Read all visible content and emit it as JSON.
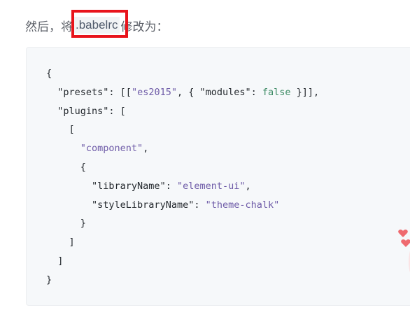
{
  "intro": {
    "prefix": "然后，将",
    "filename": ".babelrc",
    "suffix": "修改为："
  },
  "code": {
    "l1_open": "{",
    "l2_key": "\"presets\"",
    "l2_mid1": ": [[",
    "l2_es": "\"es2015\"",
    "l2_mid2": ", { ",
    "l2_modules": "\"modules\"",
    "l2_colon": ": ",
    "l2_false": "false",
    "l2_end": " }]],",
    "l3_key": "\"plugins\"",
    "l3_end": ": [",
    "l4": "[",
    "l5_str": "\"component\"",
    "l5_end": ",",
    "l6": "{",
    "l7_key": "\"libraryName\"",
    "l7_colon": ": ",
    "l7_val": "\"element-ui\"",
    "l7_end": ",",
    "l8_key": "\"styleLibraryName\"",
    "l8_colon": ": ",
    "l8_val": "\"theme-chalk\"",
    "l9": "}",
    "l10": "]",
    "l11": "]",
    "l12": "}"
  },
  "colors": {
    "highlight": "#e8141c",
    "string": "#6f5ca8",
    "keyword": "#3d8b64"
  }
}
